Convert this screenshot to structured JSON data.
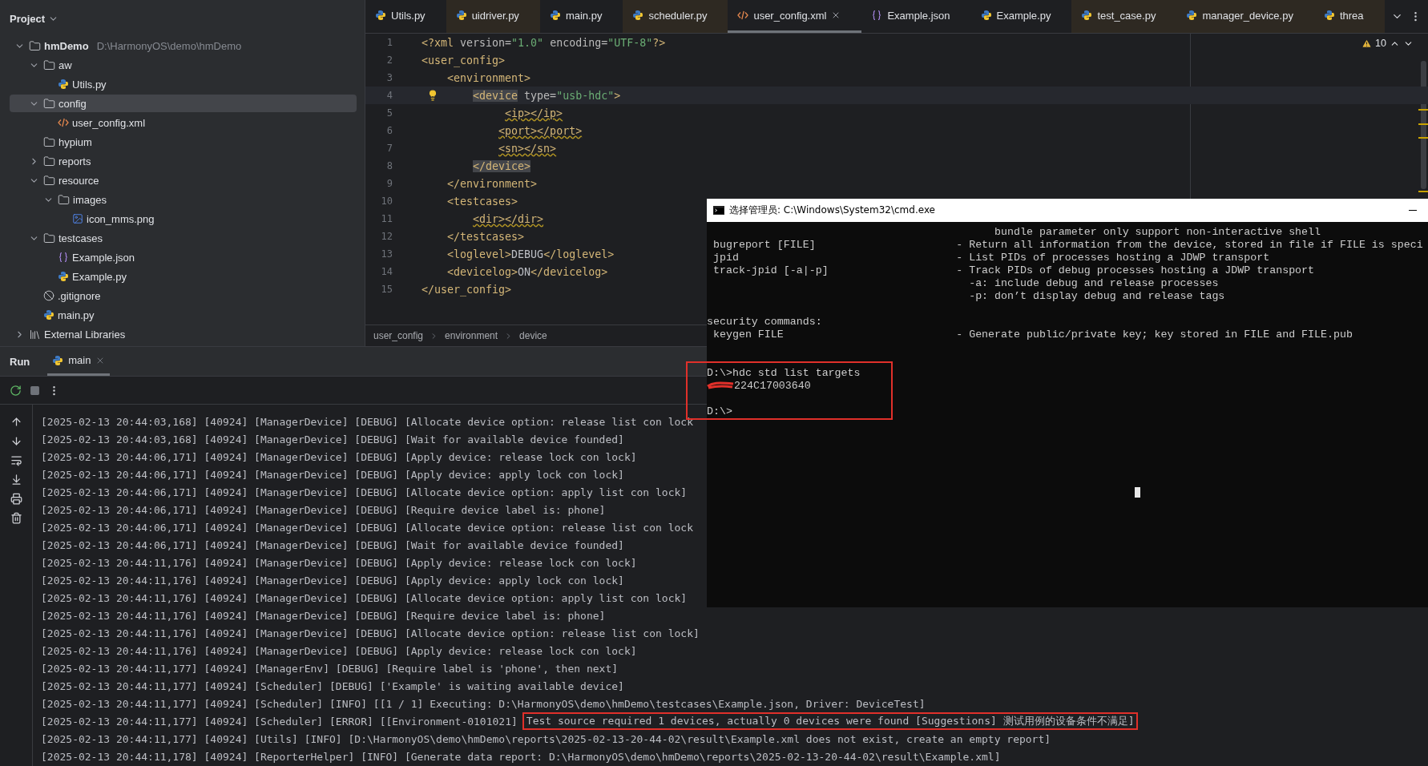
{
  "project": {
    "title": "Project",
    "tree": [
      {
        "kind": "folder",
        "name": "hmDemo",
        "path": "D:\\HarmonyOS\\demo\\hmDemo",
        "expanded": true,
        "selected": false,
        "children": [
          {
            "kind": "folder",
            "name": "aw",
            "expanded": true,
            "selected": false,
            "children": [
              {
                "kind": "python",
                "name": "Utils.py",
                "selected": false
              }
            ]
          },
          {
            "kind": "folder",
            "name": "config",
            "expanded": true,
            "selected": true,
            "children": [
              {
                "kind": "xml",
                "name": "user_config.xml",
                "selected": false
              }
            ]
          },
          {
            "kind": "folder",
            "name": "hypium",
            "selected": false
          },
          {
            "kind": "folder",
            "name": "reports",
            "expanded": false,
            "selected": false
          },
          {
            "kind": "folder",
            "name": "resource",
            "expanded": true,
            "selected": false,
            "children": [
              {
                "kind": "folder",
                "name": "images",
                "expanded": true,
                "selected": false,
                "children": [
                  {
                    "kind": "image",
                    "name": "icon_mms.png",
                    "selected": false
                  }
                ]
              }
            ]
          },
          {
            "kind": "folder",
            "name": "testcases",
            "expanded": true,
            "selected": false,
            "children": [
              {
                "kind": "json",
                "name": "Example.json",
                "selected": false
              },
              {
                "kind": "python",
                "name": "Example.py",
                "selected": false
              }
            ]
          },
          {
            "kind": "gitignore",
            "name": ".gitignore",
            "selected": false
          },
          {
            "kind": "python",
            "name": "main.py",
            "selected": false
          }
        ]
      },
      {
        "kind": "library",
        "name": "External Libraries",
        "expanded": false,
        "selected": false
      }
    ]
  },
  "tabs": [
    {
      "kind": "python",
      "name": "Utils.py",
      "selected": false,
      "tinted": false
    },
    {
      "kind": "python",
      "name": "uidriver.py",
      "selected": false,
      "tinted": true
    },
    {
      "kind": "python",
      "name": "main.py",
      "selected": false,
      "tinted": false
    },
    {
      "kind": "python",
      "name": "scheduler.py",
      "selected": false,
      "tinted": true
    },
    {
      "kind": "xml",
      "name": "user_config.xml",
      "selected": true,
      "tinted": false
    },
    {
      "kind": "json",
      "name": "Example.json",
      "selected": false,
      "tinted": false
    },
    {
      "kind": "python",
      "name": "Example.py",
      "selected": false,
      "tinted": false
    },
    {
      "kind": "python",
      "name": "test_case.py",
      "selected": false,
      "tinted": true
    },
    {
      "kind": "python",
      "name": "manager_device.py",
      "selected": false,
      "tinted": true
    },
    {
      "kind": "python",
      "name": "threa",
      "selected": false,
      "tinted": true
    }
  ],
  "editor": {
    "warnings": "10",
    "lines": [
      {
        "number": "1",
        "current": false,
        "tokens": [
          {
            "kind": "tag",
            "text": "<?xml"
          },
          {
            "kind": "attr",
            "text": " version="
          },
          {
            "kind": "string",
            "text": "\"1.0\""
          },
          {
            "kind": "attr",
            "text": " encoding="
          },
          {
            "kind": "string",
            "text": "\"UTF-8\""
          },
          {
            "kind": "tag",
            "text": "?>"
          }
        ]
      },
      {
        "number": "2",
        "current": false,
        "tokens": [
          {
            "kind": "tag",
            "text": "<user_config>"
          }
        ]
      },
      {
        "number": "3",
        "current": false,
        "tokens": [
          {
            "kind": "tag",
            "text": "    <environment>"
          }
        ]
      },
      {
        "number": "4",
        "current": true,
        "tokens": [
          {
            "kind": "match",
            "text": "        <device"
          },
          {
            "kind": "attr",
            "text": " type="
          },
          {
            "kind": "string",
            "text": "\"usb-hdc\""
          },
          {
            "kind": "tag",
            "text": ">"
          }
        ]
      },
      {
        "number": "5",
        "current": false,
        "tokens": [
          {
            "kind": "warning",
            "text": "             <ip></ip>"
          }
        ]
      },
      {
        "number": "6",
        "current": false,
        "tokens": [
          {
            "kind": "warning",
            "text": "            <port></port>"
          }
        ]
      },
      {
        "number": "7",
        "current": false,
        "tokens": [
          {
            "kind": "warning",
            "text": "            <sn></sn>"
          }
        ]
      },
      {
        "number": "8",
        "current": false,
        "tokens": [
          {
            "kind": "match",
            "text": "        </device>"
          }
        ]
      },
      {
        "number": "9",
        "current": false,
        "tokens": [
          {
            "kind": "tag",
            "text": "    </environment>"
          }
        ]
      },
      {
        "number": "10",
        "current": false,
        "tokens": [
          {
            "kind": "tag",
            "text": "    <testcases>"
          }
        ]
      },
      {
        "number": "11",
        "current": false,
        "tokens": [
          {
            "kind": "warning",
            "text": "        <dir></dir>"
          }
        ]
      },
      {
        "number": "12",
        "current": false,
        "tokens": [
          {
            "kind": "tag",
            "text": "    </testcases>"
          }
        ]
      },
      {
        "number": "13",
        "current": false,
        "tokens": [
          {
            "kind": "tag",
            "text": "    <loglevel>"
          },
          {
            "kind": "text",
            "text": "DEBUG"
          },
          {
            "kind": "tag",
            "text": "</loglevel>"
          }
        ]
      },
      {
        "number": "14",
        "current": false,
        "tokens": [
          {
            "kind": "tag",
            "text": "    <devicelog>"
          },
          {
            "kind": "text",
            "text": "ON"
          },
          {
            "kind": "tag",
            "text": "</devicelog>"
          }
        ]
      },
      {
        "number": "15",
        "current": false,
        "tokens": [
          {
            "kind": "tag",
            "text": "</user_config>"
          }
        ]
      }
    ],
    "breadcrumb": [
      "user_config",
      "environment",
      "device"
    ]
  },
  "run": {
    "title": "Run",
    "tabs": [
      {
        "name": "main",
        "selected": true
      }
    ],
    "log": [
      {
        "text": "[2025-02-13 20:44:03,168] [40924] [ManagerDevice] [DEBUG] [Allocate device option: release list con lock"
      },
      {
        "text": "[2025-02-13 20:44:03,168] [40924] [ManagerDevice] [DEBUG] [Wait for available device founded]"
      },
      {
        "text": "[2025-02-13 20:44:06,171] [40924] [ManagerDevice] [DEBUG] [Apply device: release lock con lock]"
      },
      {
        "text": "[2025-02-13 20:44:06,171] [40924] [ManagerDevice] [DEBUG] [Apply device: apply lock con lock]"
      },
      {
        "text": "[2025-02-13 20:44:06,171] [40924] [ManagerDevice] [DEBUG] [Allocate device option: apply list con lock]"
      },
      {
        "text": "[2025-02-13 20:44:06,171] [40924] [ManagerDevice] [DEBUG] [Require device label is: phone]"
      },
      {
        "text": "[2025-02-13 20:44:06,171] [40924] [ManagerDevice] [DEBUG] [Allocate device option: release list con lock"
      },
      {
        "text": "[2025-02-13 20:44:06,171] [40924] [ManagerDevice] [DEBUG] [Wait for available device founded]"
      },
      {
        "text": "[2025-02-13 20:44:11,176] [40924] [ManagerDevice] [DEBUG] [Apply device: release lock con lock]"
      },
      {
        "text": "[2025-02-13 20:44:11,176] [40924] [ManagerDevice] [DEBUG] [Apply device: apply lock con lock]"
      },
      {
        "text": "[2025-02-13 20:44:11,176] [40924] [ManagerDevice] [DEBUG] [Allocate device option: apply list con lock]"
      },
      {
        "text": "[2025-02-13 20:44:11,176] [40924] [ManagerDevice] [DEBUG] [Require device label is: phone]"
      },
      {
        "text": "[2025-02-13 20:44:11,176] [40924] [ManagerDevice] [DEBUG] [Allocate device option: release list con lock]"
      },
      {
        "text": "[2025-02-13 20:44:11,176] [40924] [ManagerDevice] [DEBUG] [Apply device: release lock con lock]"
      },
      {
        "text": "[2025-02-13 20:44:11,177] [40924] [ManagerEnv] [DEBUG] [Require label is 'phone', then next]"
      },
      {
        "text": "[2025-02-13 20:44:11,177] [40924] [Scheduler] [DEBUG] ['Example' is waiting available device]"
      },
      {
        "text": "[2025-02-13 20:44:11,177] [40924] [Scheduler] [INFO] [[1 / 1] Executing: D:\\HarmonyOS\\demo\\hmDemo\\testcases\\Example.json, Driver: DeviceTest]"
      },
      {
        "text": "[2025-02-13 20:44:11,177] [40924] [Scheduler] [ERROR] [[Environment-0101021]",
        "boxed": "Test source required 1 devices, actually 0 devices were found [Suggestions] 测试用例的设备条件不满足]"
      },
      {
        "text": "[2025-02-13 20:44:11,177] [40924] [Utils] [INFO] [D:\\HarmonyOS\\demo\\hmDemo\\reports\\2025-02-13-20-44-02\\result\\Example.xml does not exist, create an empty report]"
      },
      {
        "text": "[2025-02-13 20:44:11,178] [40924] [ReporterHelper] [INFO] [Generate data report: D:\\HarmonyOS\\demo\\hmDemo\\reports\\2025-02-13-20-44-02\\result\\Example.xml]"
      }
    ]
  },
  "cmd": {
    "title": "选择管理员: C:\\Windows\\System32\\cmd.exe",
    "lines": [
      {
        "kind": "text",
        "text": "                                             bundle parameter only support non-interactive shell"
      },
      {
        "kind": "text",
        "text": " bugreport [FILE]                      - Return all information from the device, stored in file if FILE is speci"
      },
      {
        "kind": "text",
        "text": " jpid                                  - List PIDs of processes hosting a JDWP transport"
      },
      {
        "kind": "text",
        "text": " track-jpid [-a|-p]                    - Track PIDs of debug processes hosting a JDWP transport"
      },
      {
        "kind": "text",
        "text": "                                         -a: include debug and release processes"
      },
      {
        "kind": "text",
        "text": "                                         -p: don’t display debug and release tags"
      },
      {
        "kind": "blank"
      },
      {
        "kind": "text",
        "text": "security commands:"
      },
      {
        "kind": "text",
        "text": " keygen FILE                           - Generate public/private key; key stored in FILE and FILE.pub"
      },
      {
        "kind": "blank"
      },
      {
        "kind": "blank"
      },
      {
        "kind": "text",
        "text": "D:\\>hdc std list targets",
        "boxed": true
      },
      {
        "kind": "redacted",
        "text": "224C17003640"
      },
      {
        "kind": "blank"
      },
      {
        "kind": "text",
        "text": "D:\\>"
      }
    ]
  }
}
